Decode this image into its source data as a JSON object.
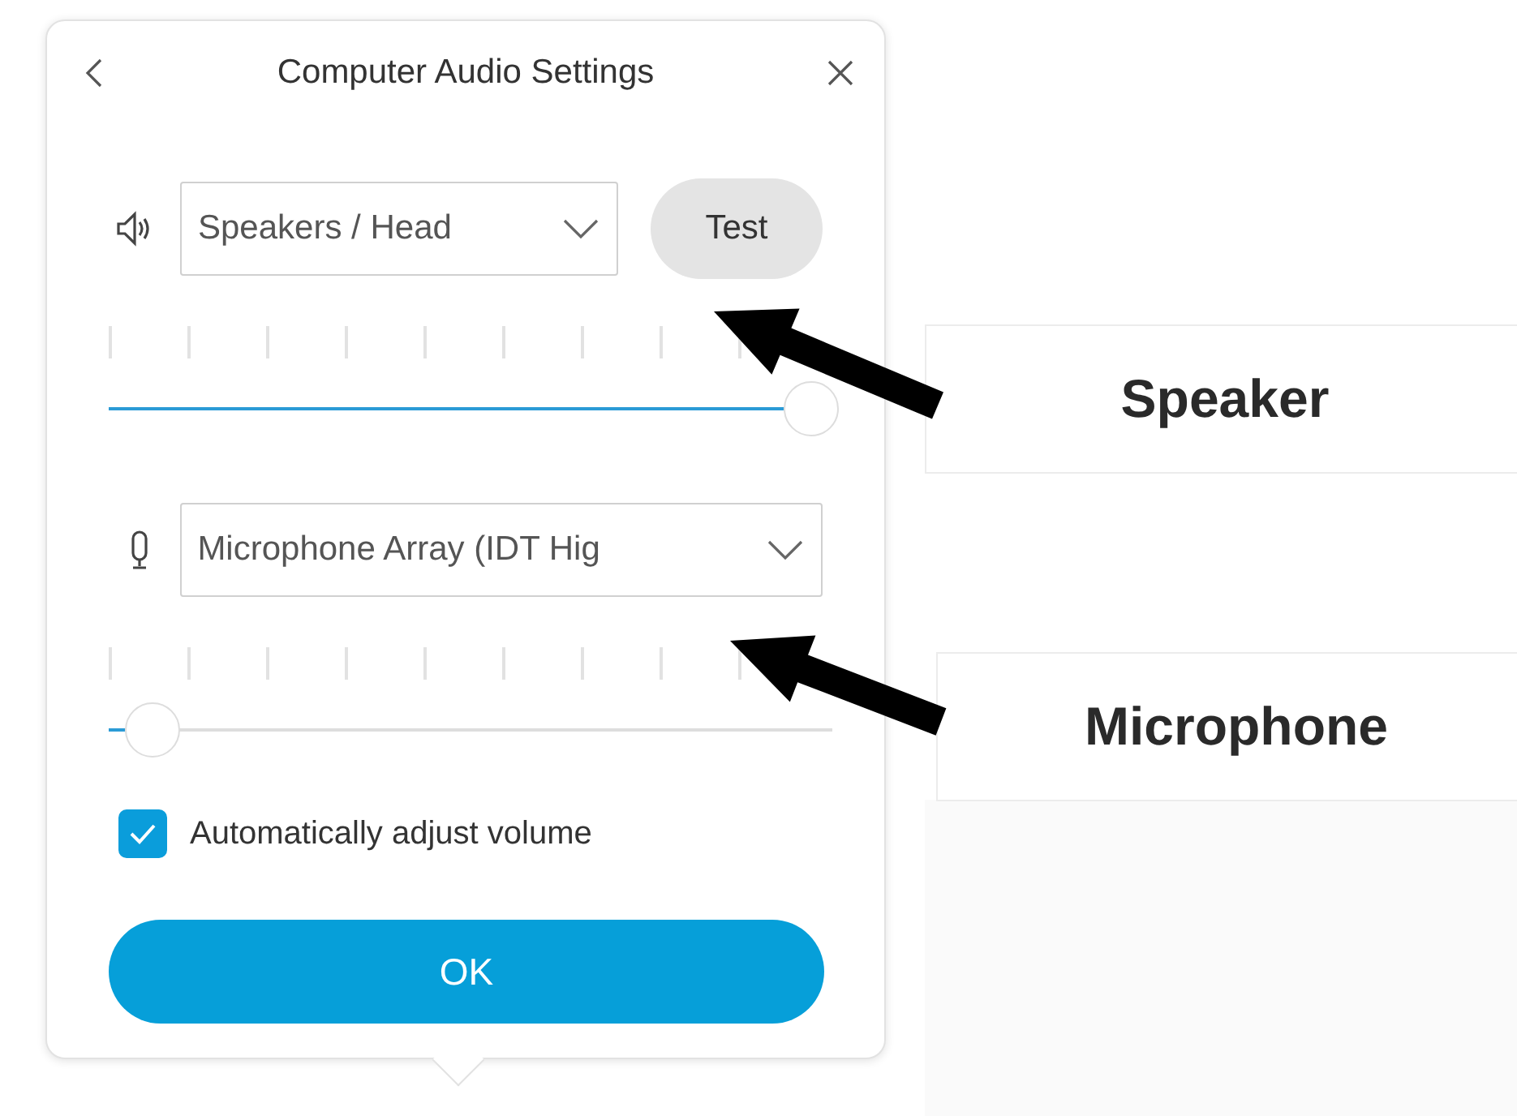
{
  "dialog": {
    "title": "Computer Audio Settings",
    "devices": [
      {
        "kind": "speaker",
        "device": "Speakers / Head",
        "level": 0.97,
        "test_button": "Test"
      },
      {
        "kind": "microphone",
        "device": "Microphone Array (IDT Hig",
        "level": 0.06
      }
    ],
    "auto_adjust": {
      "label": "Automatically adjust volume",
      "checked": true
    },
    "ok_button": "OK"
  },
  "annotations": [
    {
      "label": "Speaker"
    },
    {
      "label": "Microphone"
    }
  ]
}
